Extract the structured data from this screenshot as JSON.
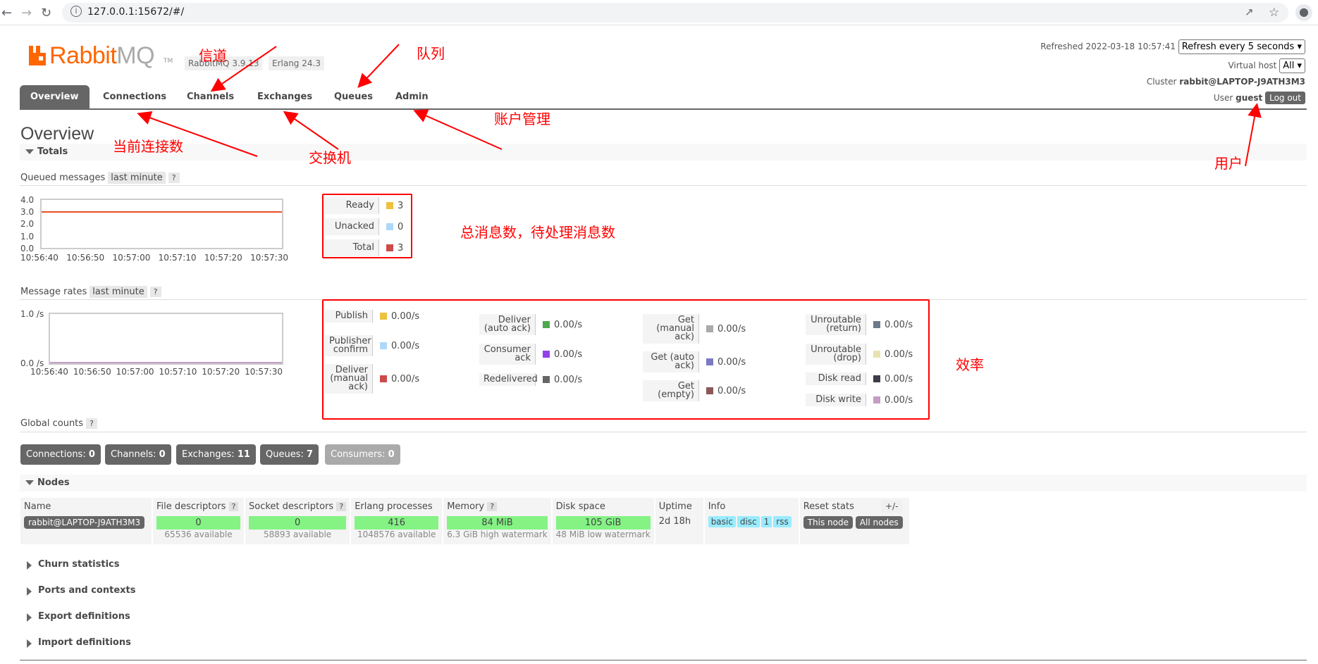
{
  "browser": {
    "url": "127.0.0.1:15672/#/"
  },
  "header": {
    "logo_rabbit": "Rabbit",
    "logo_mq": "MQ",
    "logo_tm": "TM",
    "rabbitmq_version": "RabbitMQ 3.9.13",
    "erlang_version": "Erlang 24.3",
    "refreshed": "Refreshed 2022-03-18 10:57:41",
    "refresh_select": "Refresh every 5 seconds",
    "virtual_host_label": "Virtual host",
    "virtual_host_select": "All",
    "cluster_label": "Cluster",
    "cluster_name": "rabbit@LAPTOP-J9ATH3M3",
    "user_label": "User",
    "user_name": "guest",
    "logout_label": "Log out"
  },
  "tabs": [
    {
      "label": "Overview",
      "active": true
    },
    {
      "label": "Connections"
    },
    {
      "label": "Channels"
    },
    {
      "label": "Exchanges"
    },
    {
      "label": "Queues"
    },
    {
      "label": "Admin"
    }
  ],
  "page_title": "Overview",
  "totals": {
    "section_title": "Totals",
    "queued_label": "Queued messages",
    "queued_range": "last minute",
    "help": "?",
    "queued_y_ticks": [
      "4.0",
      "3.0",
      "2.0",
      "1.0",
      "0.0"
    ],
    "x_ticks": [
      "10:56:40",
      "10:56:50",
      "10:57:00",
      "10:57:10",
      "10:57:20",
      "10:57:30"
    ],
    "queued_legend": [
      {
        "label": "Ready",
        "value": "3",
        "color": "#edc240"
      },
      {
        "label": "Unacked",
        "value": "0",
        "color": "#afd8f8"
      },
      {
        "label": "Total",
        "value": "3",
        "color": "#cb4b4b"
      }
    ],
    "rates_label": "Message rates",
    "rates_range": "last minute",
    "rates_y_ticks": [
      "1.0 /s",
      "0.0 /s"
    ],
    "rates_legend": [
      [
        {
          "label": "Publish",
          "value": "0.00/s",
          "color": "#edc240"
        },
        {
          "label": "Publisher confirm",
          "value": "0.00/s",
          "color": "#afd8f8"
        },
        {
          "label": "Deliver (manual ack)",
          "value": "0.00/s",
          "color": "#cb4b4b"
        }
      ],
      [
        {
          "label": "Deliver (auto ack)",
          "value": "0.00/s",
          "color": "#4da74d"
        },
        {
          "label": "Consumer ack",
          "value": "0.00/s",
          "color": "#9440ed"
        },
        {
          "label": "Redelivered",
          "value": "0.00/s",
          "color": "#666666"
        }
      ],
      [
        {
          "label": "Get (manual ack)",
          "value": "0.00/s",
          "color": "#aaaaaa"
        },
        {
          "label": "Get (auto ack)",
          "value": "0.00/s",
          "color": "#7c79c3"
        },
        {
          "label": "Get (empty)",
          "value": "0.00/s",
          "color": "#8a5858"
        }
      ],
      [
        {
          "label": "Unroutable (return)",
          "value": "0.00/s",
          "color": "#6c7a89"
        },
        {
          "label": "Unroutable (drop)",
          "value": "0.00/s",
          "color": "#e7e3b0"
        },
        {
          "label": "Disk read",
          "value": "0.00/s",
          "color": "#3d3d4a"
        },
        {
          "label": "Disk write",
          "value": "0.00/s",
          "color": "#c49cc4"
        }
      ]
    ],
    "global_label": "Global counts"
  },
  "chart_data": [
    {
      "type": "line",
      "title": "",
      "x": [
        "10:56:40",
        "10:56:50",
        "10:57:00",
        "10:57:10",
        "10:57:20",
        "10:57:30"
      ],
      "ylim": [
        0,
        4
      ],
      "series": [
        {
          "name": "Ready",
          "values": [
            3,
            3,
            3,
            3,
            3,
            3
          ]
        },
        {
          "name": "Total",
          "values": [
            3,
            3,
            3,
            3,
            3,
            3
          ]
        }
      ]
    },
    {
      "type": "line",
      "title": "",
      "x": [
        "10:56:40",
        "10:56:50",
        "10:57:00",
        "10:57:10",
        "10:57:20",
        "10:57:30"
      ],
      "ylim": [
        0,
        1
      ],
      "series": [
        {
          "name": "Publish",
          "values": [
            0,
            0,
            0,
            0,
            0,
            0
          ]
        }
      ]
    }
  ],
  "global_counts": [
    {
      "label": "Connections:",
      "value": "0"
    },
    {
      "label": "Channels:",
      "value": "0"
    },
    {
      "label": "Exchanges:",
      "value": "11"
    },
    {
      "label": "Queues:",
      "value": "7"
    },
    {
      "label": "Consumers:",
      "value": "0"
    }
  ],
  "nodes": {
    "section_title": "Nodes",
    "headers": [
      "Name",
      "File descriptors",
      "Socket descriptors",
      "Erlang processes",
      "Memory",
      "Disk space",
      "Uptime",
      "Info",
      "Reset stats"
    ],
    "plusminus": "+/-",
    "row": {
      "name": "rabbit@LAPTOP-J9ATH3M3",
      "file_descriptors": "0",
      "file_available": "65536 available",
      "socket_descriptors": "0",
      "socket_available": "58893 available",
      "erlang_processes": "416",
      "erlang_available": "1048576 available",
      "memory": "84 MiB",
      "memory_watermark": "6.3 GiB high watermark",
      "disk": "105 GiB",
      "disk_watermark": "48 MiB low watermark",
      "uptime": "2d 18h",
      "info": [
        "basic",
        "disc",
        "1",
        "rss"
      ],
      "reset_this": "This node",
      "reset_all": "All nodes"
    }
  },
  "collapsed_sections": [
    "Churn statistics",
    "Ports and contexts",
    "Export definitions",
    "Import definitions"
  ],
  "annotations": {
    "channels": "信道",
    "queues": "队列",
    "connections": "当前连接数",
    "exchanges": "交换机",
    "admin": "账户管理",
    "user": "用户",
    "messages": "总消息数，待处理消息数",
    "rates": "效率"
  }
}
